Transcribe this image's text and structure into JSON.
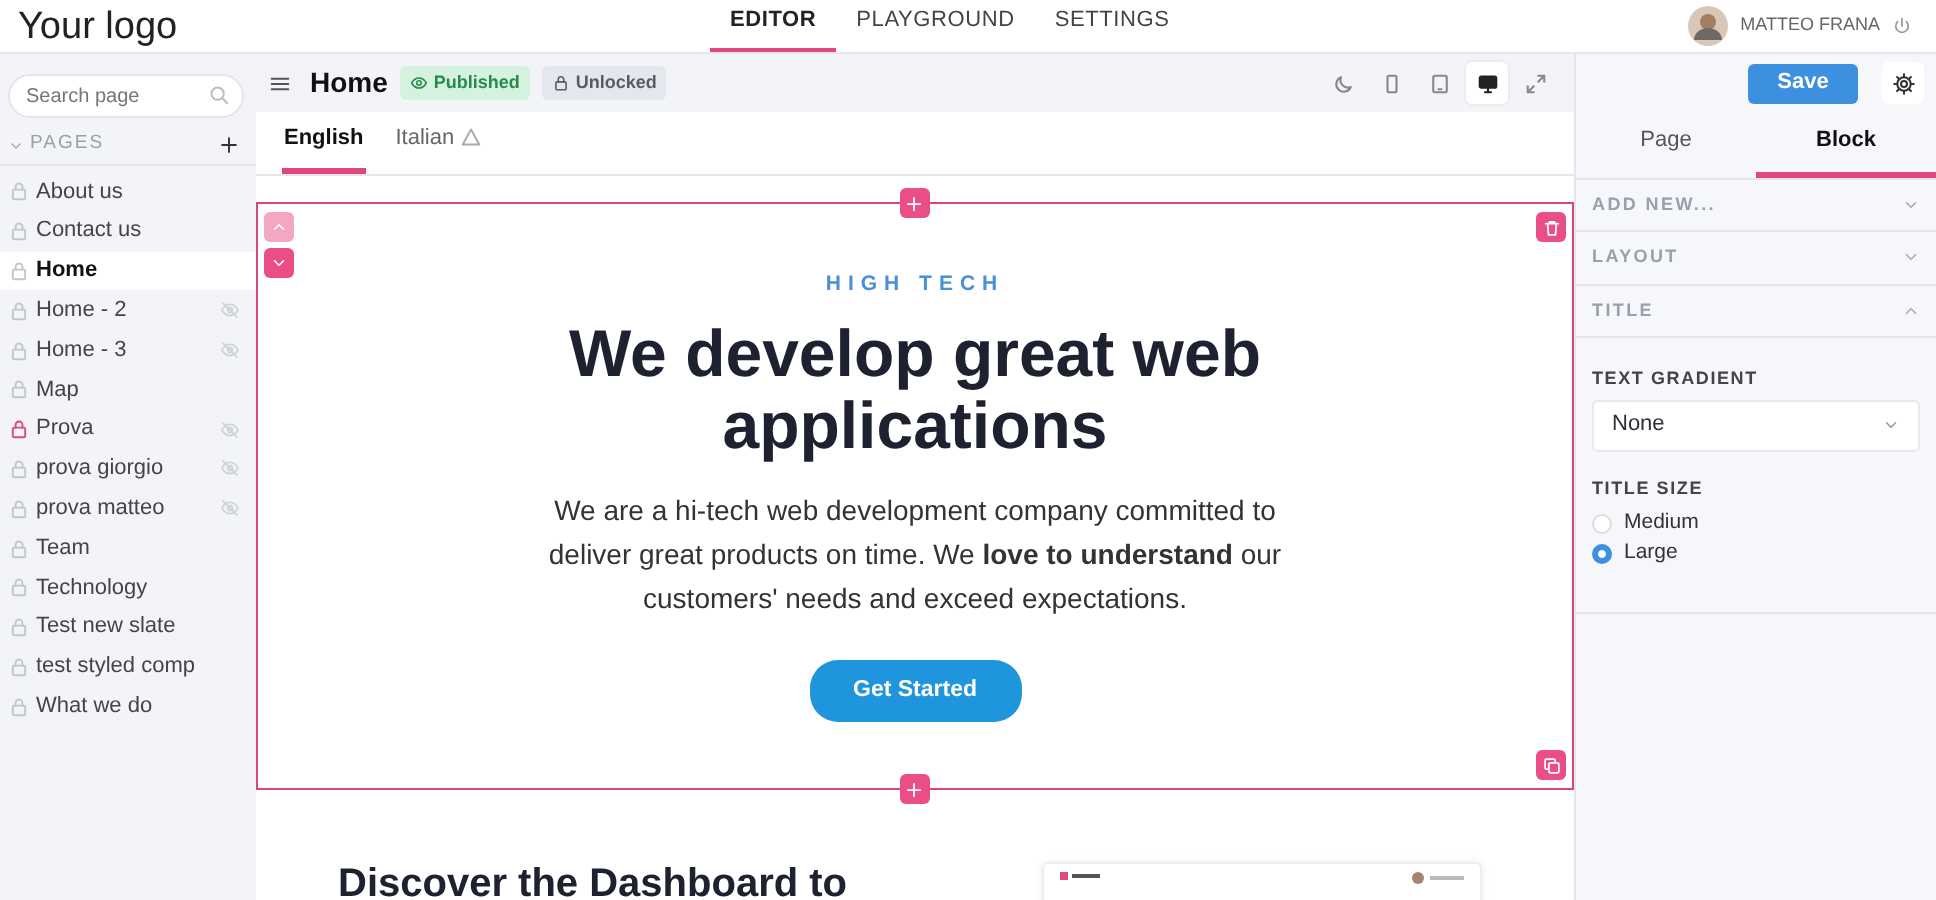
{
  "header": {
    "logo": "Your logo",
    "nav": [
      {
        "label": "EDITOR",
        "selected": true
      },
      {
        "label": "PLAYGROUND",
        "selected": false
      },
      {
        "label": "SETTINGS",
        "selected": false
      }
    ],
    "user": {
      "name": "MATTEO FRANA"
    }
  },
  "sidebar": {
    "search": {
      "placeholder": "Search page"
    },
    "section": {
      "title": "PAGES",
      "expanded": true
    },
    "pages": [
      {
        "label": "About us",
        "selected": false,
        "locked": false,
        "hidden": false
      },
      {
        "label": "Contact us",
        "selected": false,
        "locked": false,
        "hidden": false
      },
      {
        "label": "Home",
        "selected": true,
        "locked": false,
        "hidden": false
      },
      {
        "label": "Home - 2",
        "selected": false,
        "locked": false,
        "hidden": true
      },
      {
        "label": "Home - 3",
        "selected": false,
        "locked": false,
        "hidden": true
      },
      {
        "label": "Map",
        "selected": false,
        "locked": false,
        "hidden": false
      },
      {
        "label": "Prova",
        "selected": false,
        "locked": true,
        "hidden": true
      },
      {
        "label": "prova giorgio",
        "selected": false,
        "locked": false,
        "hidden": true
      },
      {
        "label": "prova matteo",
        "selected": false,
        "locked": false,
        "hidden": true
      },
      {
        "label": "Team",
        "selected": false,
        "locked": false,
        "hidden": false
      },
      {
        "label": "Technology",
        "selected": false,
        "locked": false,
        "hidden": false
      },
      {
        "label": "Test new slate",
        "selected": false,
        "locked": false,
        "hidden": false
      },
      {
        "label": "test styled comp",
        "selected": false,
        "locked": false,
        "hidden": false
      },
      {
        "label": "What we do",
        "selected": false,
        "locked": false,
        "hidden": false
      }
    ]
  },
  "toolbar": {
    "page_title": "Home",
    "badges": [
      {
        "label": "Published",
        "kind": "published"
      },
      {
        "label": "Unlocked",
        "kind": "unlocked"
      }
    ],
    "devices": [
      {
        "kind": "dark-mode",
        "selected": false
      },
      {
        "kind": "phone",
        "selected": false
      },
      {
        "kind": "tablet",
        "selected": false
      },
      {
        "kind": "desktop",
        "selected": true
      },
      {
        "kind": "fullscreen",
        "selected": false
      }
    ]
  },
  "language_tabs": [
    {
      "label": "English",
      "selected": true,
      "warning": false
    },
    {
      "label": "Italian",
      "selected": false,
      "warning": true
    }
  ],
  "block": {
    "eyebrow": "HIGH TECH",
    "title": "We develop great web applications",
    "text": "We are a hi-tech web development company committed to deliver great products on time. We **love to understand** our customers' needs and exceed expectations.",
    "button": "Get Started"
  },
  "next_block": {
    "title": "Discover the Dashboard to"
  },
  "panel": {
    "save": "Save",
    "tabs": [
      {
        "label": "Page",
        "selected": false
      },
      {
        "label": "Block",
        "selected": true
      }
    ],
    "sections": [
      {
        "title": "ADD NEW...",
        "expanded": false
      },
      {
        "title": "LAYOUT",
        "expanded": false
      },
      {
        "title": "TITLE",
        "expanded": true
      }
    ],
    "text_gradient": {
      "label": "TEXT GRADIENT",
      "value": "None"
    },
    "title_size": {
      "label": "TITLE SIZE",
      "options": [
        {
          "label": "Medium",
          "selected": false
        },
        {
          "label": "Large",
          "selected": true
        }
      ]
    }
  }
}
